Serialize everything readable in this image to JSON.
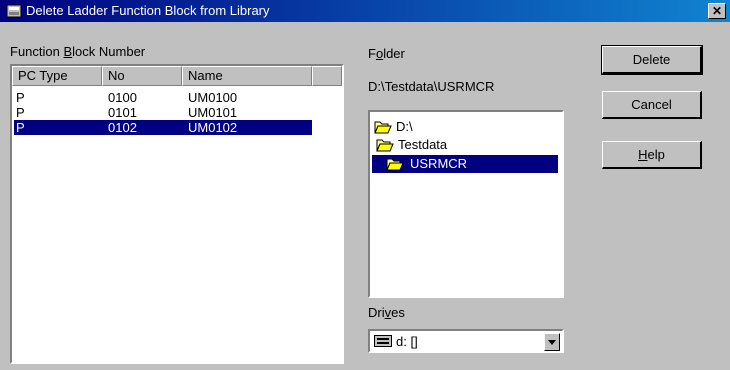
{
  "window": {
    "title": "Delete Ladder Function Block from Library",
    "close_glyph": "✕"
  },
  "function_block": {
    "label_pre": "Function ",
    "label_key": "B",
    "label_post": "lock Number",
    "columns": [
      "PC Type",
      "No",
      "Name"
    ],
    "rows": [
      {
        "pc_type": "P",
        "no": "0100",
        "name": "UM0100",
        "selected": false
      },
      {
        "pc_type": "P",
        "no": "0101",
        "name": "UM0101",
        "selected": false
      },
      {
        "pc_type": "P",
        "no": "0102",
        "name": "UM0102",
        "selected": true
      }
    ]
  },
  "folder": {
    "label_pre": "F",
    "label_key": "o",
    "label_post": "lder",
    "path": "D:\\Testdata\\USRMCR",
    "tree": [
      {
        "label": "D:\\",
        "icon": "folder-open-icon"
      },
      {
        "label": "Testdata",
        "icon": "folder-open-icon"
      },
      {
        "label": "USRMCR",
        "icon": "folder-open-icon",
        "selected": true
      }
    ]
  },
  "drives": {
    "label_pre": "Dri",
    "label_key": "v",
    "label_post": "es",
    "value": "d: []",
    "icon": "drive-icon"
  },
  "buttons": {
    "delete": "Delete",
    "cancel": "Cancel",
    "help_key": "H",
    "help_rest": "elp"
  }
}
